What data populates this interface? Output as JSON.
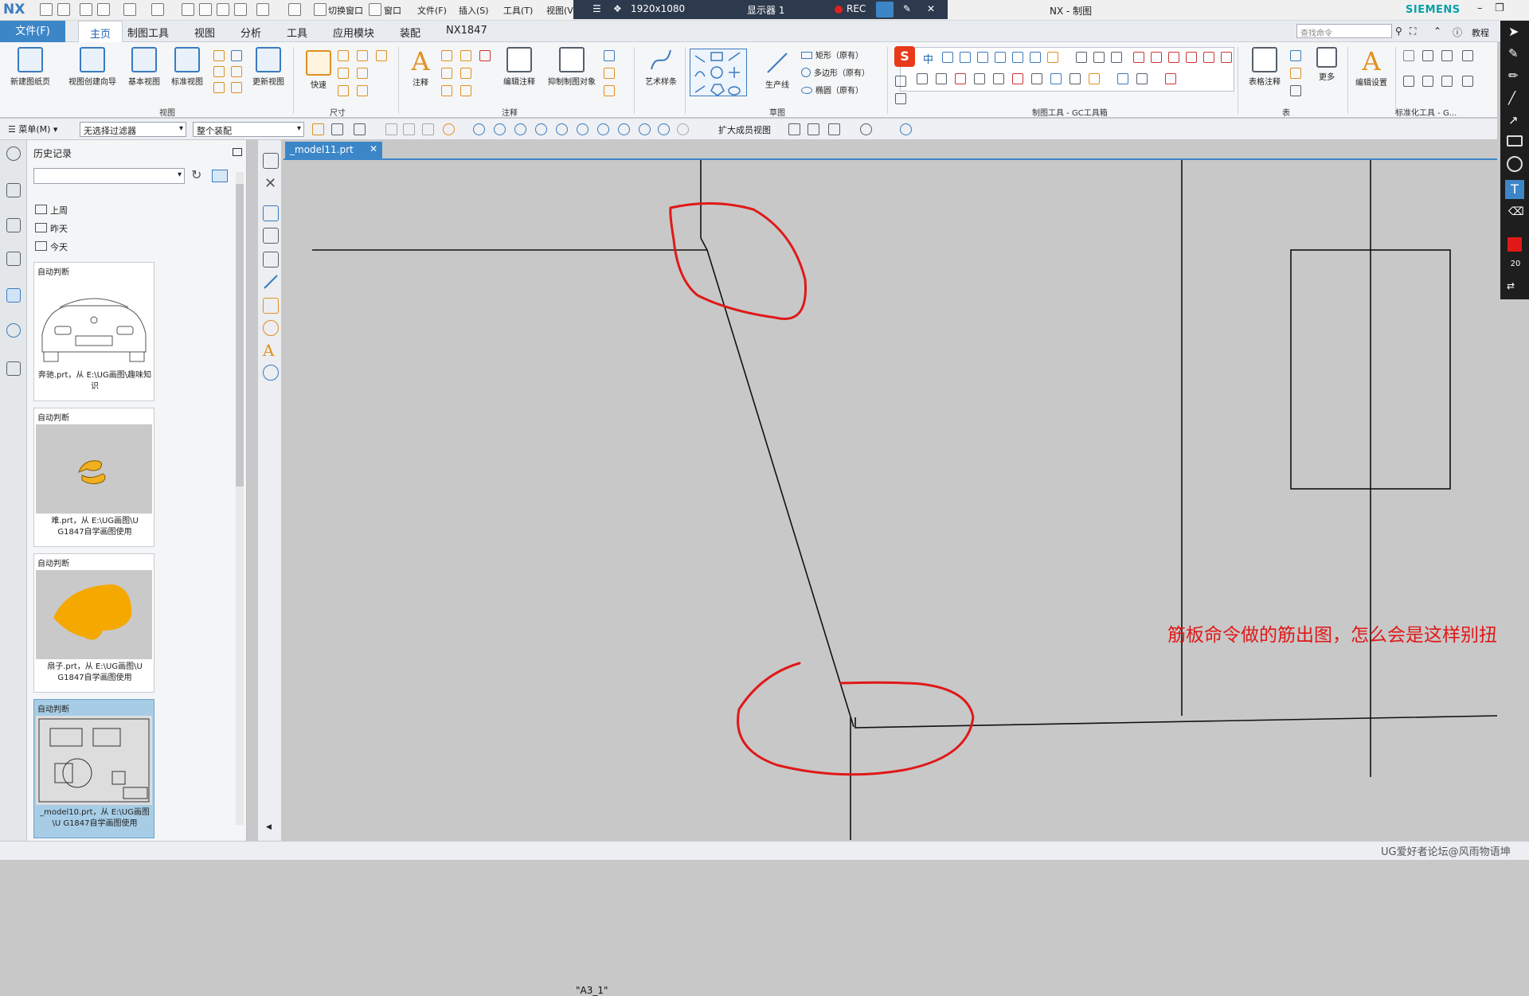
{
  "titlebar": {
    "logo": "NX",
    "quick_items": [
      "切换窗口",
      "窗口",
      "文件(F)",
      "插入(S)",
      "工具(T)",
      "视图(V)"
    ],
    "window_title": "NX - 制图",
    "brand": "SIEMENS"
  },
  "recorder": {
    "resolution": "1920x1080",
    "display": "显示器 1",
    "rec_label": "REC"
  },
  "menubar": {
    "file": "文件(F)",
    "tabs": [
      "主页",
      "制图工具",
      "视图",
      "分析",
      "工具",
      "应用模块",
      "装配",
      "NX1847"
    ],
    "active_tab": "主页",
    "search_placeholder": "查找命令",
    "tutorial": "教程"
  },
  "ribbon": {
    "view_group": {
      "buttons": [
        "新建图纸页",
        "视图创建向导",
        "基本视图",
        "标准视图",
        "更新视图"
      ],
      "name": "视图"
    },
    "dimension_group": {
      "buttons": [
        "快速"
      ],
      "name": "尺寸"
    },
    "annotation_group": {
      "buttons": [
        "注释",
        "编辑注释",
        "抑制制图对象"
      ],
      "name": "注释"
    },
    "spline": "艺术样条",
    "sketch_group": {
      "buttons": [
        "生产线"
      ],
      "shapes": [
        "矩形（原有）",
        "多边形（原有）",
        "椭圆（原有）"
      ],
      "name": "草图"
    },
    "gc_group": {
      "name": "制图工具 - GC工具箱",
      "badge": "中"
    },
    "table_group": {
      "buttons": [
        "表格注释",
        "更多"
      ],
      "name": "表"
    },
    "settings": {
      "button": "编辑设置",
      "name": "标准化工具 - G..."
    }
  },
  "cmdbar": {
    "menu": "菜单(M)",
    "filter": "无选择过滤器",
    "scope": "整个装配",
    "expand_label": "扩大成员视图"
  },
  "history": {
    "title": "历史记录",
    "folders": [
      "上周",
      "昨天",
      "今天"
    ],
    "cards": [
      {
        "header": "自动判断",
        "caption": "奔驰.prt，从 E:\\UG画图\\趣味知识"
      },
      {
        "header": "自动判断",
        "caption": "难.prt，从 E:\\UG画图\\U G1847自学画图使用"
      },
      {
        "header": "自动判断",
        "caption": "扇子.prt，从 E:\\UG画图\\U G1847自学画图使用"
      },
      {
        "header": "自动判断",
        "caption": "_model10.prt，从 E:\\UG画图\\U G1847自学画图使用"
      }
    ]
  },
  "document": {
    "tab": "_model11.prt",
    "sheet": "\"A3_1\""
  },
  "annotation": {
    "text": "筋板命令做的筋出图，怎么会是这样别扭",
    "color": "#e01818"
  },
  "pen_toolbar": {
    "text_tool": "T",
    "color": "#e01818",
    "size": "20"
  },
  "status": {
    "watermark": "UG爱好者论坛@风雨物语坤"
  }
}
